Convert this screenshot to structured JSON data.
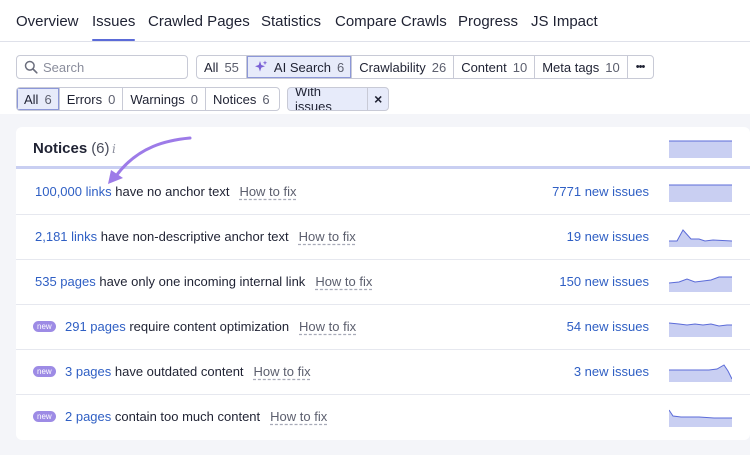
{
  "nav": {
    "tabs": [
      {
        "label": "Overview"
      },
      {
        "label": "Issues",
        "active": true
      },
      {
        "label": "Crawled Pages"
      },
      {
        "label": "Statistics"
      },
      {
        "label": "Compare Crawls"
      },
      {
        "label": "Progress"
      },
      {
        "label": "JS Impact"
      }
    ]
  },
  "search": {
    "placeholder": "Search"
  },
  "categories": [
    {
      "label": "All",
      "count": "55"
    },
    {
      "label": "AI Search",
      "count": "6",
      "selected": true
    },
    {
      "label": "Crawlability",
      "count": "26"
    },
    {
      "label": "Content",
      "count": "10"
    },
    {
      "label": "Meta tags",
      "count": "10"
    },
    {
      "label": "•••"
    }
  ],
  "severity": [
    {
      "label": "All",
      "count": "6",
      "selected": true
    },
    {
      "label": "Errors",
      "count": "0"
    },
    {
      "label": "Warnings",
      "count": "0"
    },
    {
      "label": "Notices",
      "count": "6"
    }
  ],
  "filter_chip": {
    "label": "With issues",
    "close": "×"
  },
  "card": {
    "title": "Notices",
    "count": "(6)",
    "info": "i",
    "how_to_fix": "How to fix",
    "new_badge": "new",
    "rows": [
      {
        "link": "100,000 links",
        "text": " have no anchor text",
        "new_issues": "7771 new issues",
        "badge": false
      },
      {
        "link": "2,181 links",
        "text": " have non-descriptive anchor text",
        "new_issues": "19 new issues",
        "badge": false
      },
      {
        "link": "535 pages",
        "text": " have only one incoming internal link",
        "new_issues": "150 new issues",
        "badge": false
      },
      {
        "link": "291 pages",
        "text": " require content optimization",
        "new_issues": "54 new issues",
        "badge": true
      },
      {
        "link": "3 pages",
        "text": " have outdated content",
        "new_issues": "3 new issues",
        "badge": true
      },
      {
        "link": "2 pages",
        "text": " contain too much content",
        "new_issues": "",
        "badge": true
      }
    ]
  },
  "colors": {
    "accent": "#5b6bd8",
    "link": "#2f5fc4",
    "badge": "#9d8be5",
    "sparkline_fill": "#c9cff2",
    "arrow": "#9d7be8"
  }
}
